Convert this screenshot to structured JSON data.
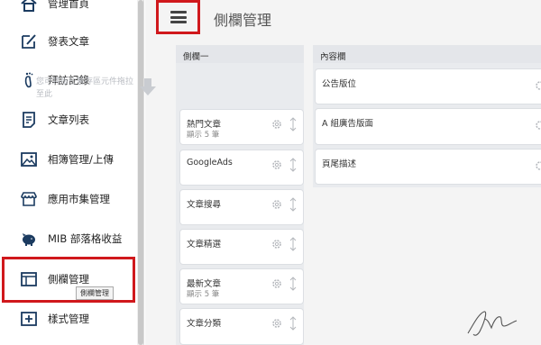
{
  "sidebar": {
    "items": [
      {
        "label": "管理首頁",
        "icon": "home-icon"
      },
      {
        "label": "發表文章",
        "icon": "edit-icon"
      },
      {
        "label": "拜訪記錄",
        "icon": "footprint-icon"
      },
      {
        "label": "文章列表",
        "icon": "document-list-icon"
      },
      {
        "label": "相簿管理/上傳",
        "icon": "photo-icon"
      },
      {
        "label": "應用市集管理",
        "icon": "store-icon"
      },
      {
        "label": "MIB 部落格收益",
        "icon": "piggy-bank-icon"
      },
      {
        "label": "側欄管理",
        "icon": "sidebar-layout-icon"
      },
      {
        "label": "樣式管理",
        "icon": "style-icon"
      }
    ],
    "active_item": "側欄管理",
    "tooltip": "側欄管理"
  },
  "header": {
    "menu_icon": "hamburger-menu-icon",
    "title": "側欄管理"
  },
  "columns": {
    "sidebar1": {
      "title": "側欄一",
      "hint": "您可將版位暫存區元件拖拉至此",
      "hint_icon": "arrow-down-icon",
      "cards": [
        {
          "title": "熱門文章",
          "sub": "顯示 5 筆"
        },
        {
          "title": "GoogleAds",
          "sub": ""
        },
        {
          "title": "文章搜尋",
          "sub": ""
        },
        {
          "title": "文章精選",
          "sub": ""
        },
        {
          "title": "最新文章",
          "sub": "顯示 5 筆"
        },
        {
          "title": "文章分類",
          "sub": ""
        }
      ]
    },
    "content": {
      "title": "內容欄",
      "cards": [
        {
          "title": "公告版位",
          "sub": ""
        },
        {
          "title": "A 組廣告版面",
          "sub": ""
        },
        {
          "title": "頁尾描述",
          "sub": ""
        }
      ]
    }
  },
  "signature_icon": "signature-icon",
  "colors": {
    "highlight": "#d0181c",
    "main_bg": "#f4f4f4",
    "column_bg": "#e9ebee",
    "icon_blue": "#1b3b60"
  }
}
